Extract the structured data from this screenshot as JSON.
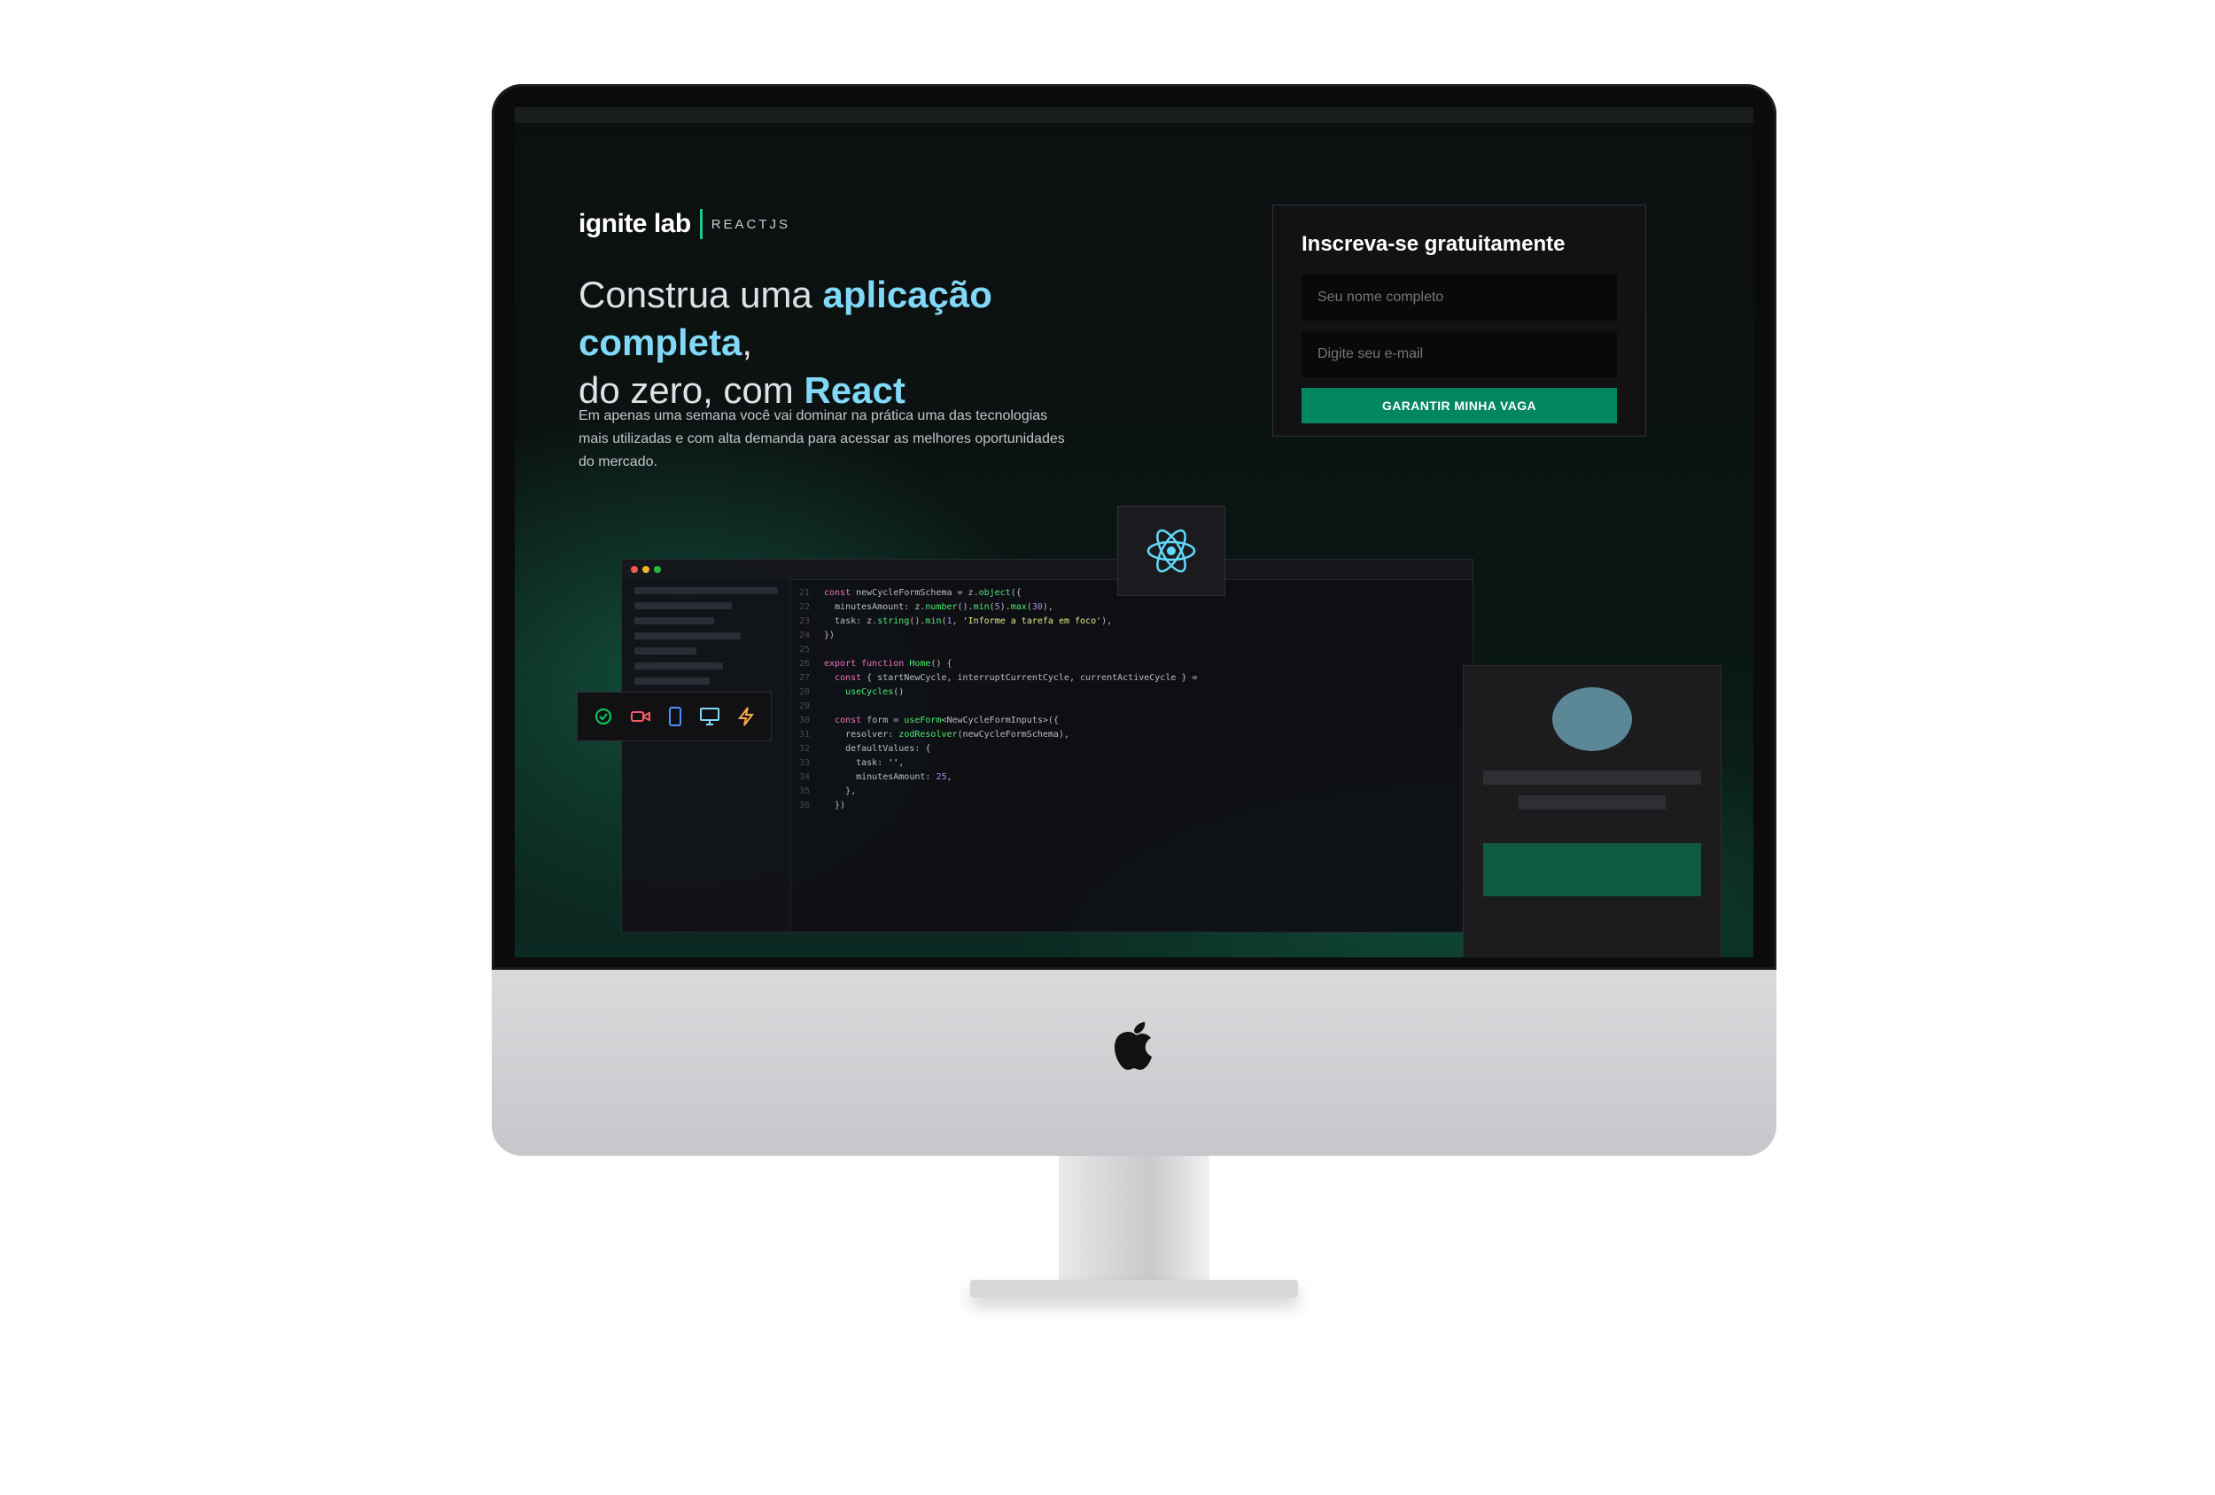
{
  "brand": {
    "name": "ignite lab",
    "subtitle": "REACTJS"
  },
  "hero": {
    "headline_part1": "Construa uma ",
    "headline_highlight1": "aplicação completa",
    "headline_part2": ",",
    "headline_part3": "do zero, com ",
    "headline_highlight2": "React",
    "description": "Em apenas uma semana você vai dominar na prática uma das tecnologias mais utilizadas e com alta demanda para acessar as melhores oportunidades do mercado."
  },
  "signup": {
    "title": "Inscreva-se gratuitamente",
    "name_placeholder": "Seu nome completo",
    "email_placeholder": "Digite seu e-mail",
    "submit_label": "GARANTIR MINHA VAGA"
  },
  "colors": {
    "accent_green": "#00875f",
    "highlight_blue": "#81d8f7",
    "background": "#09090a"
  },
  "icons": [
    "apple-logo",
    "react-icon",
    "check-icon",
    "video-icon",
    "phone-icon",
    "monitor-icon",
    "lightning-icon"
  ]
}
